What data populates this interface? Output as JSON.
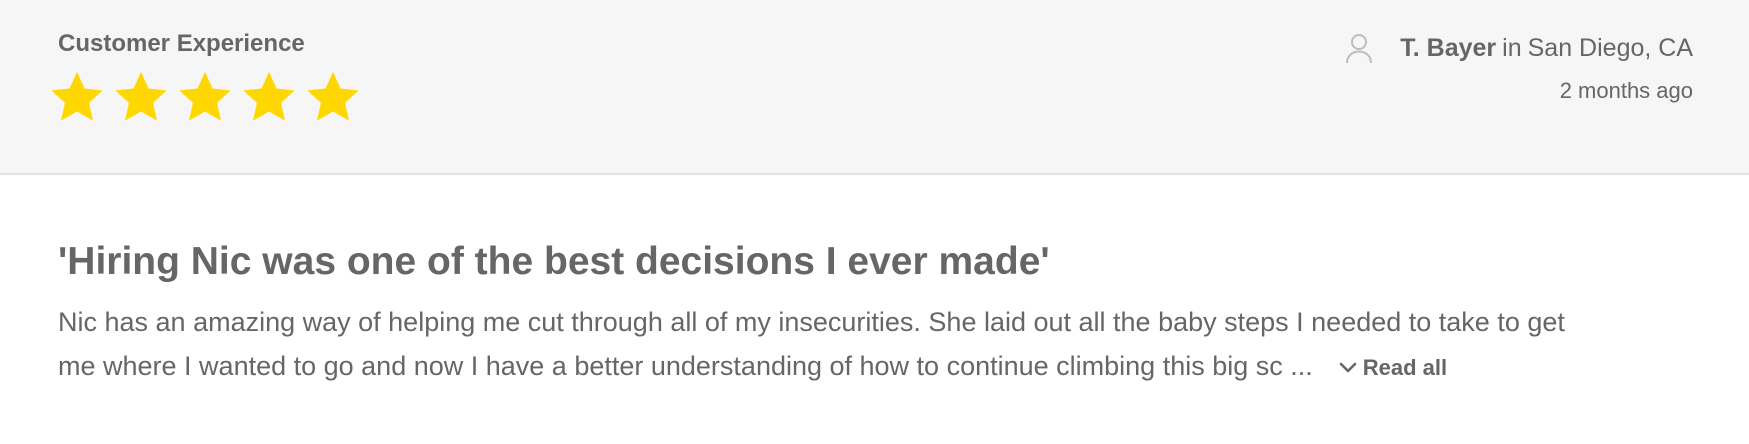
{
  "review": {
    "category": "Customer Experience",
    "rating": {
      "value": 5,
      "max": 5,
      "color": "#FFD700"
    },
    "reviewer": {
      "icon": "user-icon",
      "name": "T. Bayer",
      "connector": "in",
      "location": "San Diego, CA"
    },
    "time_ago": "2 months ago",
    "title": "'Hiring Nic was one of the best decisions I ever made'",
    "excerpt": "Nic has an amazing way of helping me cut through all of my insecurities. She laid out all the baby steps I needed to take to get me where I wanted to go and now I have a better understanding of how to continue climbing this big sc ...",
    "read_all_label": "Read all",
    "read_all_icon": "chevron-down-icon"
  },
  "colors": {
    "header_background": "#f6f6f6",
    "text": "#666666",
    "star": "#FFD700"
  }
}
